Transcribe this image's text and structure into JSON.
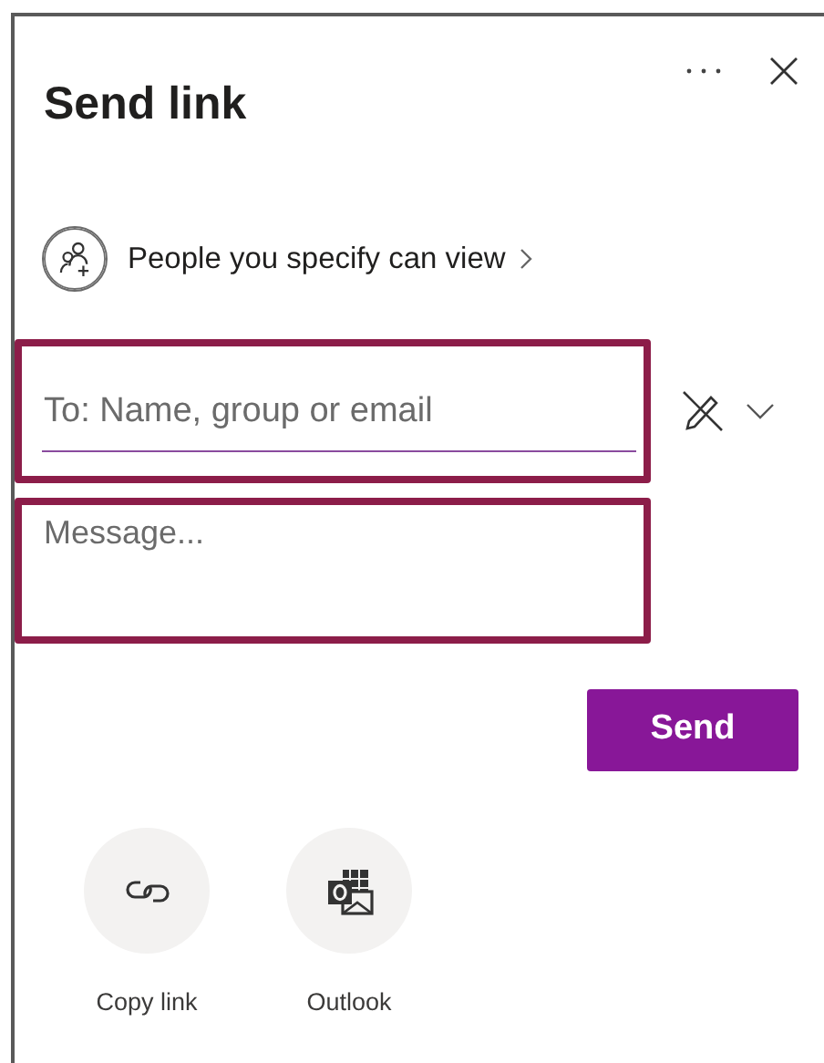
{
  "header": {
    "title": "Send link"
  },
  "permission": {
    "label": "People you specify can view"
  },
  "recipient": {
    "placeholder": "To: Name, group or email",
    "highlighted": true
  },
  "message": {
    "placeholder": "Message...",
    "highlighted": true
  },
  "send_button": "Send",
  "share_options": [
    {
      "kind": "copy-link",
      "label": "Copy link"
    },
    {
      "kind": "outlook",
      "label": "Outlook"
    }
  ]
}
